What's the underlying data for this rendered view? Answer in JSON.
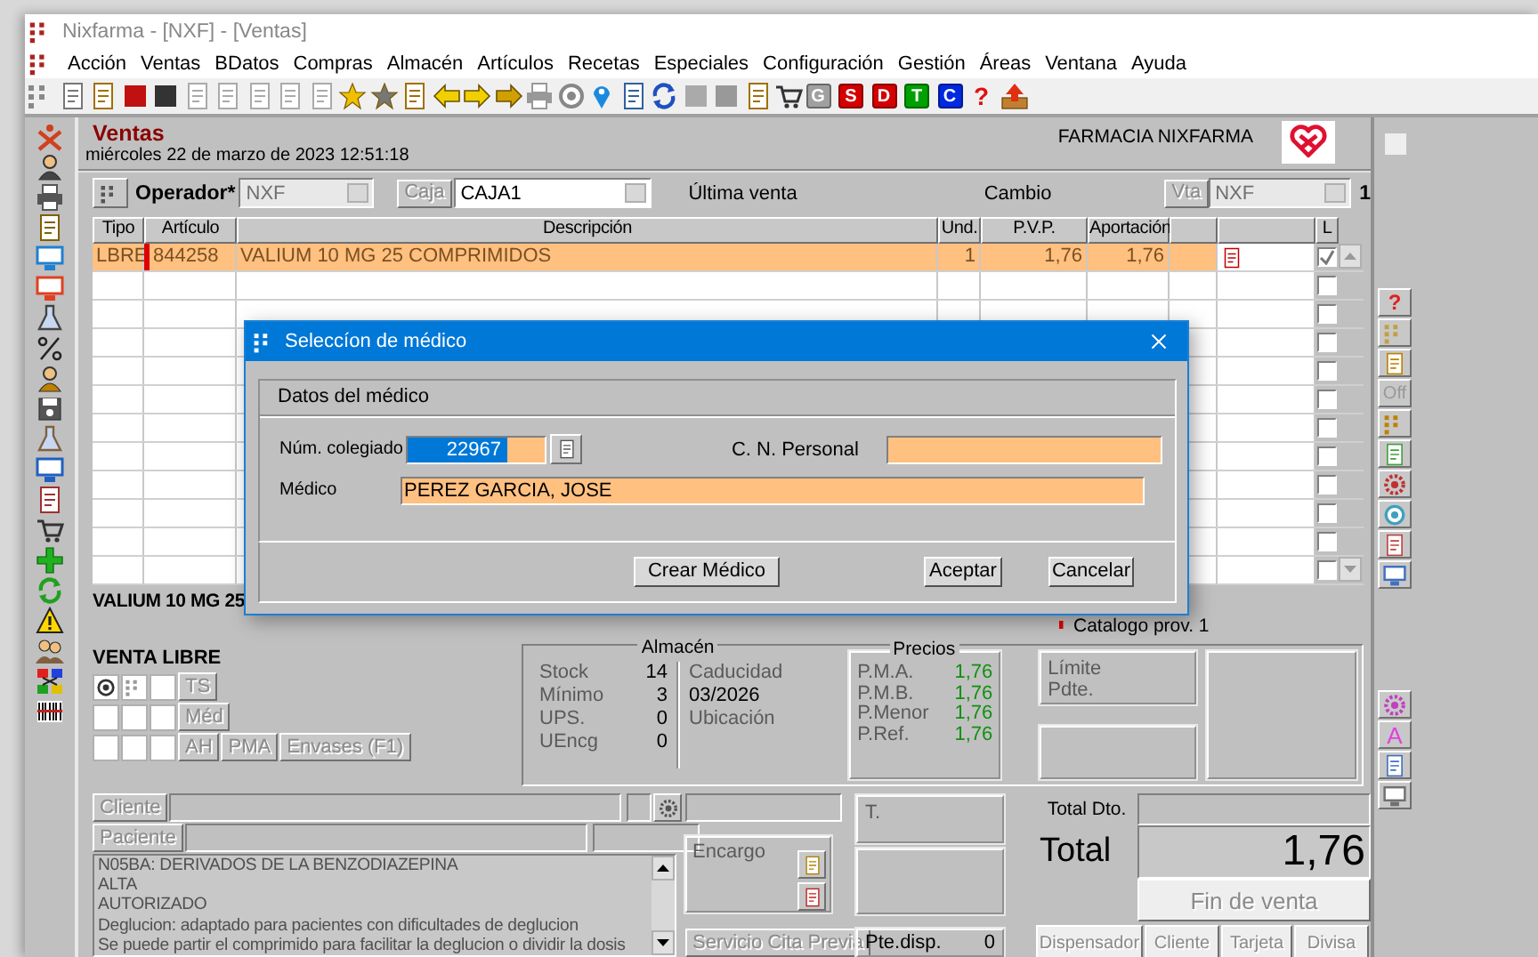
{
  "window": {
    "title": "Nixfarma - [NXF] - [Ventas]"
  },
  "menu": [
    "Acción",
    "Ventas",
    "BDatos",
    "Compras",
    "Almacén",
    "Artículos",
    "Recetas",
    "Especiales",
    "Configuración",
    "Gestión",
    "Áreas",
    "Ventana",
    "Ayuda"
  ],
  "toolbar": {
    "letter_buttons": [
      {
        "label": "G",
        "color": "#a0a0a0"
      },
      {
        "label": "S",
        "color": "#d40000"
      },
      {
        "label": "D",
        "color": "#d40000"
      },
      {
        "label": "T",
        "color": "#00a000"
      },
      {
        "label": "C",
        "color": "#0028e0"
      }
    ],
    "help": "?"
  },
  "header": {
    "title": "Ventas",
    "date": "miércoles 22 de marzo de 2023 12:51:18",
    "pharmacy": "FARMACIA NIXFARMA"
  },
  "operator_bar": {
    "operator_label": "Operador*",
    "operator": "NXF",
    "caja_button": {
      "label": "Caja",
      "disabled": true
    },
    "caja": "CAJA1",
    "last_sale": "Última venta",
    "change": "Cambio",
    "vta_button": {
      "label": "Vta",
      "disabled": true
    },
    "vta": "NXF",
    "count": "1"
  },
  "table": {
    "columns": [
      "Tipo",
      "Artículo",
      "Descripción",
      "Und.",
      "P.V.P.",
      "Aportación",
      "L"
    ],
    "rows": [
      {
        "tipo": "LBRE",
        "articulo": "844258",
        "descripcion": "VALIUM 10 MG 25 COMPRIMIDOS",
        "und": "1",
        "pvp": "1,76",
        "aportacion": "1,76",
        "selected": true,
        "marked": true,
        "attachment": true,
        "checked": true
      },
      {
        "selected": false,
        "marked": false,
        "attachment": false,
        "checked": false
      },
      {
        "selected": false,
        "marked": false,
        "attachment": false,
        "checked": false
      },
      {
        "selected": false,
        "marked": false,
        "attachment": false,
        "checked": false
      },
      {
        "selected": false,
        "marked": false,
        "attachment": false,
        "checked": false
      },
      {
        "selected": false,
        "marked": false,
        "attachment": false,
        "checked": false
      },
      {
        "selected": false,
        "marked": false,
        "attachment": false,
        "checked": false
      },
      {
        "selected": false,
        "marked": false,
        "attachment": false,
        "checked": false
      },
      {
        "selected": false,
        "marked": false,
        "attachment": false,
        "checked": false
      },
      {
        "selected": false,
        "marked": false,
        "attachment": false,
        "checked": false
      },
      {
        "selected": false,
        "marked": false,
        "attachment": false,
        "checked": false
      },
      {
        "selected": false,
        "marked": false,
        "attachment": false,
        "checked": false
      }
    ]
  },
  "product": {
    "name": "VALIUM 10 MG 25",
    "catalog": "Catalogo prov. 1"
  },
  "sale_type": {
    "title": "VENTA LIBRE",
    "buttons": [
      {
        "label": "TS",
        "disabled": true
      },
      {
        "label": "Méd",
        "disabled": true
      },
      {
        "label": "AH",
        "disabled": true
      },
      {
        "label": "PMA",
        "disabled": true
      },
      {
        "label": "Envases (F1)",
        "disabled": true
      }
    ]
  },
  "almacen": {
    "title": "Almacén",
    "stock": [
      {
        "label": "Stock",
        "value": "14"
      },
      {
        "label": "Mínimo",
        "value": "3"
      },
      {
        "label": "UPS.",
        "value": "0"
      },
      {
        "label": "UEncg",
        "value": "0"
      }
    ],
    "details": [
      {
        "label": "Caducidad",
        "value": "03/2026"
      },
      {
        "label": "Ubicación"
      }
    ]
  },
  "precios": {
    "title": "Precios",
    "rows": [
      {
        "label": "P.M.A.",
        "value": "1,76"
      },
      {
        "label": "P.M.B.",
        "value": "1,76"
      },
      {
        "label": "P.Menor",
        "value": "1,76"
      },
      {
        "label": "P.Ref.",
        "value": "1,76"
      }
    ]
  },
  "credit": {
    "limit": "Límite",
    "pending": "Pdte."
  },
  "customer": {
    "cliente_button": {
      "label": "Cliente",
      "disabled": true
    },
    "paciente_button": {
      "label": "Paciente",
      "disabled": true
    }
  },
  "notes": [
    "N05BA: DERIVADOS DE LA BENZODIAZEPINA",
    "ALTA",
    "AUTORIZADO",
    "Deglucion: adaptado para pacientes con dificultades de deglucion",
    "Se puede partir el comprimido para facilitar la deglucion o dividir la dosis"
  ],
  "encargo": {
    "label": "Encargo"
  },
  "appointment_button": {
    "label": "Servicio Cita Previa",
    "disabled": true
  },
  "t_box": {
    "label": "T."
  },
  "pending_dispense": {
    "label": "Pte.disp.",
    "value": "0"
  },
  "totals": {
    "discount_label": "Total Dto.",
    "total_label": "Total",
    "total": "1,76"
  },
  "finish_button": {
    "label": "Fin de venta",
    "disabled": true
  },
  "payment_buttons": [
    {
      "label": "Dispensador",
      "disabled": true
    },
    {
      "label": "Cliente",
      "disabled": true
    },
    {
      "label": "Tarjeta",
      "disabled": true
    },
    {
      "label": "Divisa",
      "disabled": true
    }
  ],
  "side_toolbar": {
    "help": "?",
    "off": "Off",
    "letter": "A",
    "checked": false
  },
  "dialog": {
    "title": "Seleccíon de médico",
    "group": "Datos del médico",
    "colegiado_label": "Núm. colegiado",
    "colegiado": "22967",
    "cn_label": "C. N. Personal",
    "medico_label": "Médico",
    "medico": "PEREZ GARCIA, JOSE",
    "buttons": [
      {
        "label": "Crear Médico"
      },
      {
        "label": "Aceptar"
      },
      {
        "label": "Cancelar"
      }
    ]
  }
}
